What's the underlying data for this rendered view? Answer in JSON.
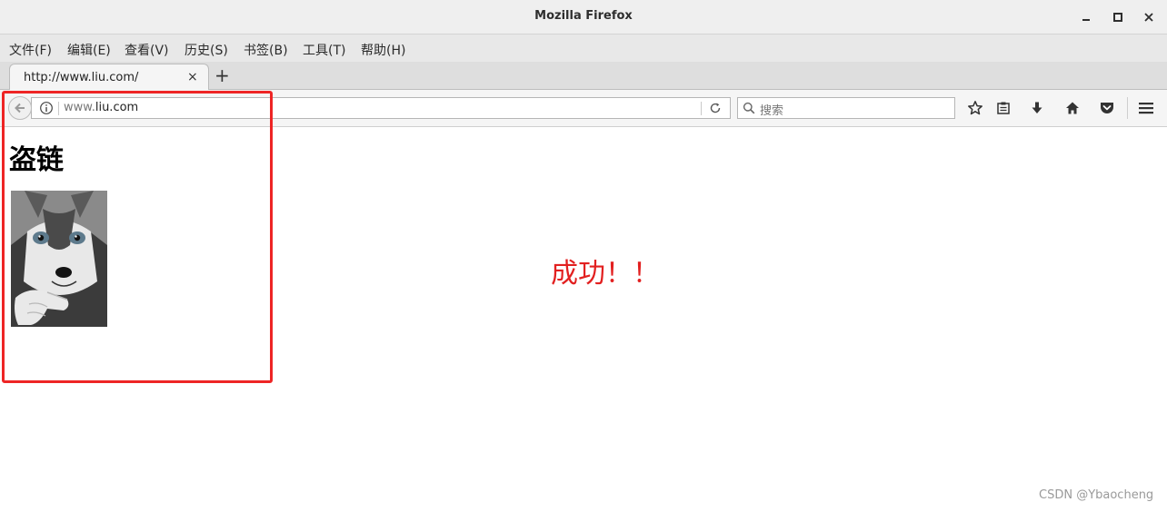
{
  "window": {
    "title": "Mozilla Firefox"
  },
  "menubar": {
    "items": [
      "文件(F)",
      "编辑(E)",
      "查看(V)",
      "历史(S)",
      "书签(B)",
      "工具(T)",
      "帮助(H)"
    ]
  },
  "tab": {
    "label": "http://www.liu.com/",
    "close_glyph": "×",
    "new_glyph": "+"
  },
  "navbar": {
    "url_prefix": "www.",
    "url_domain": "liu.com",
    "search_placeholder": "搜索"
  },
  "page": {
    "heading": "盗链",
    "success_text": "成功！！",
    "image_icon": "husky-dog-image"
  },
  "annotation": {
    "color": "#ee2525"
  },
  "watermark": "CSDN @Ybaocheng"
}
